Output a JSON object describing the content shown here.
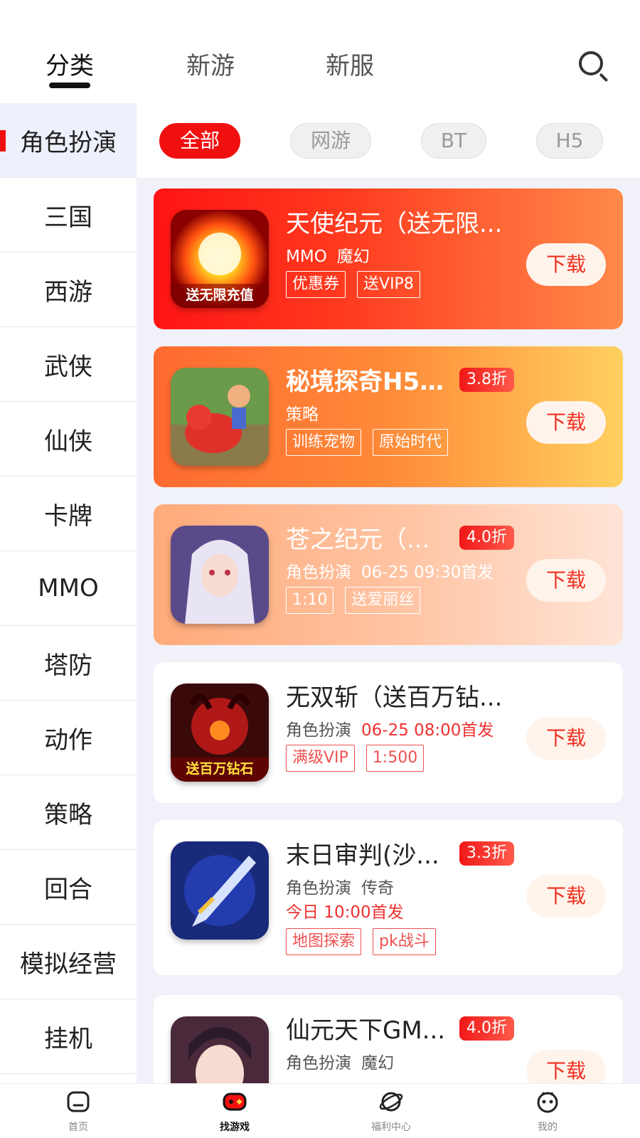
{
  "top_tabs": [
    {
      "label": "分类",
      "active": true
    },
    {
      "label": "新游",
      "active": false
    },
    {
      "label": "新服",
      "active": false
    }
  ],
  "search_icon": "search-icon",
  "sidebar": {
    "items": [
      {
        "label": "角色扮演",
        "active": true
      },
      {
        "label": "三国"
      },
      {
        "label": "西游"
      },
      {
        "label": "武侠"
      },
      {
        "label": "仙侠"
      },
      {
        "label": "卡牌"
      },
      {
        "label": "MMO"
      },
      {
        "label": "塔防"
      },
      {
        "label": "动作"
      },
      {
        "label": "策略"
      },
      {
        "label": "回合"
      },
      {
        "label": "模拟经营"
      },
      {
        "label": "挂机"
      }
    ]
  },
  "filters": [
    {
      "label": "全部",
      "active": true
    },
    {
      "label": "网游"
    },
    {
      "label": "BT"
    },
    {
      "label": "H5"
    }
  ],
  "games": [
    {
      "title": "天使纪元（送无限...",
      "discount": "",
      "genre": "MMO",
      "sub": "魔幻",
      "launch": "",
      "tags": [
        "优惠券",
        "送VIP8"
      ],
      "button": "下载"
    },
    {
      "title": "秘境探奇H5...",
      "discount": "3.8折",
      "genre": "策略",
      "sub": "",
      "launch": "",
      "tags": [
        "训练宠物",
        "原始时代"
      ],
      "button": "下载"
    },
    {
      "title": "苍之纪元（...",
      "discount": "4.0折",
      "genre": "角色扮演",
      "sub": "06-25 09:30首发",
      "launch": "",
      "tags": [
        "1:10",
        "送爱丽丝"
      ],
      "button": "下载"
    },
    {
      "title": "无双斩（送百万钻...",
      "discount": "",
      "genre": "角色扮演",
      "sub": "06-25 08:00首发",
      "launch": "",
      "tags": [
        "满级VIP",
        "1:500"
      ],
      "button": "下载"
    },
    {
      "title": "末日审判(沙...",
      "discount": "3.3折",
      "genre": "角色扮演",
      "sub": "传奇",
      "launch": "今日 10:00首发",
      "tags": [
        "地图探索",
        "pk战斗"
      ],
      "button": "下载"
    },
    {
      "title": "仙元天下GM...",
      "discount": "4.0折",
      "genre": "角色扮演",
      "sub": "魔幻",
      "launch": "",
      "tags": [],
      "button": "下载"
    }
  ],
  "icon_texts": {
    "game0": "送无限充值",
    "game3": "送百万钻石"
  },
  "bottom_nav": [
    {
      "label": "首页",
      "icon": "home-icon"
    },
    {
      "label": "找游戏",
      "icon": "gamepad-icon",
      "active": true
    },
    {
      "label": "福利中心",
      "icon": "planet-icon"
    },
    {
      "label": "我的",
      "icon": "profile-icon"
    }
  ],
  "colors": {
    "accent": "#f01010",
    "sidebar_active_bg": "#eef0fb",
    "main_bg": "#f1f2f9"
  }
}
